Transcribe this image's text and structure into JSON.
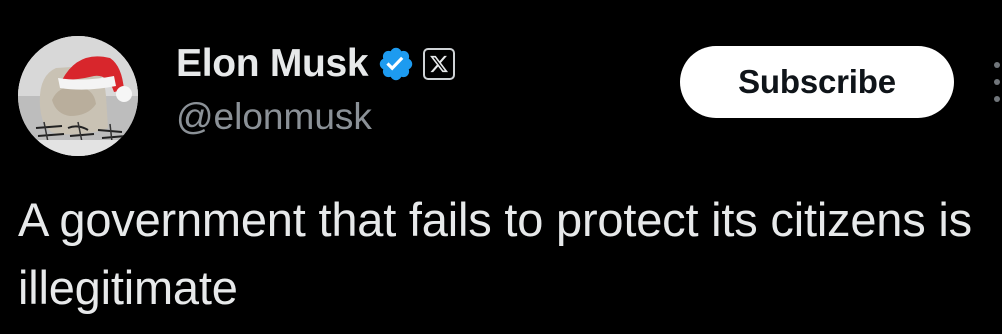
{
  "author": {
    "display_name": "Elon Musk",
    "handle": "@elonmusk",
    "verified": true,
    "verified_color": "#1d9bf0",
    "affiliate_badge": "x-logo-icon",
    "avatar": "avatar-santa-hat"
  },
  "actions": {
    "subscribe_label": "Subscribe",
    "more_icon": "more-dots-icon"
  },
  "tweet": {
    "text": "A government that fails to protect its citizens is illegitimate"
  },
  "colors": {
    "background": "#000000",
    "text_primary": "#e7e9ea",
    "text_secondary": "#8b9197",
    "button_bg": "#ffffff",
    "button_text": "#0f1419"
  }
}
